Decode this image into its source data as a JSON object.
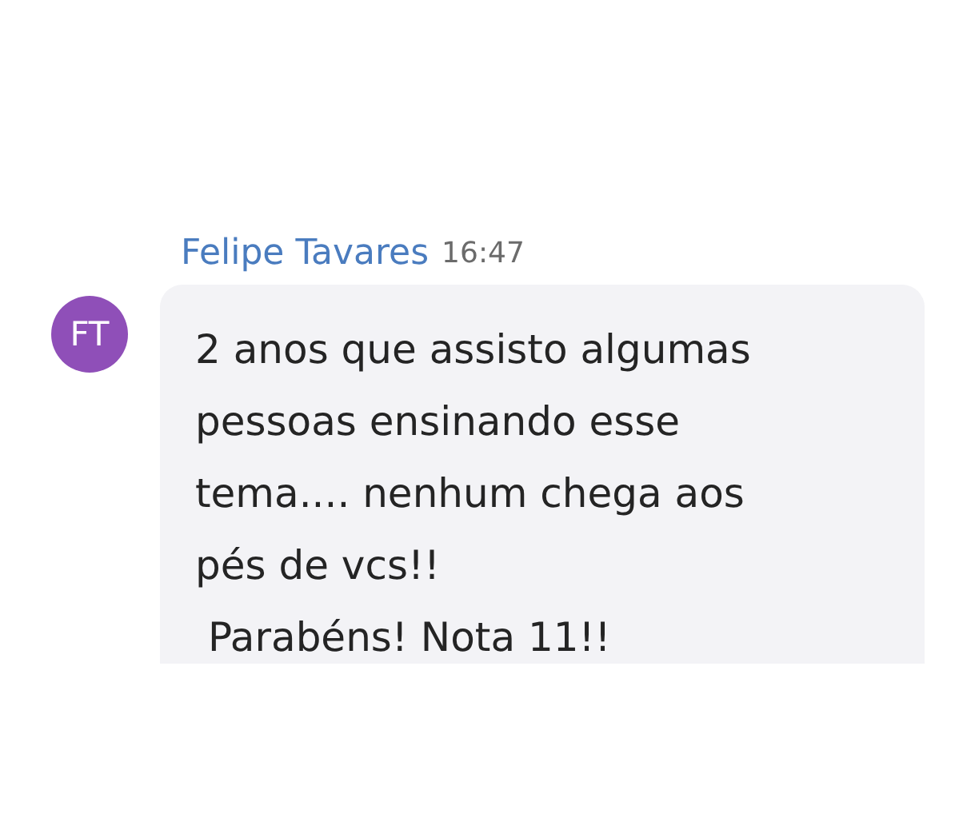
{
  "message": {
    "author": "Felipe Tavares",
    "time": "16:47",
    "avatar_initials": "FT",
    "text": "2 anos que assisto algumas\npessoas ensinando esse\ntema.... nenhum chega aos\npés de vcs!!\n Parabéns! Nota 11!!"
  }
}
